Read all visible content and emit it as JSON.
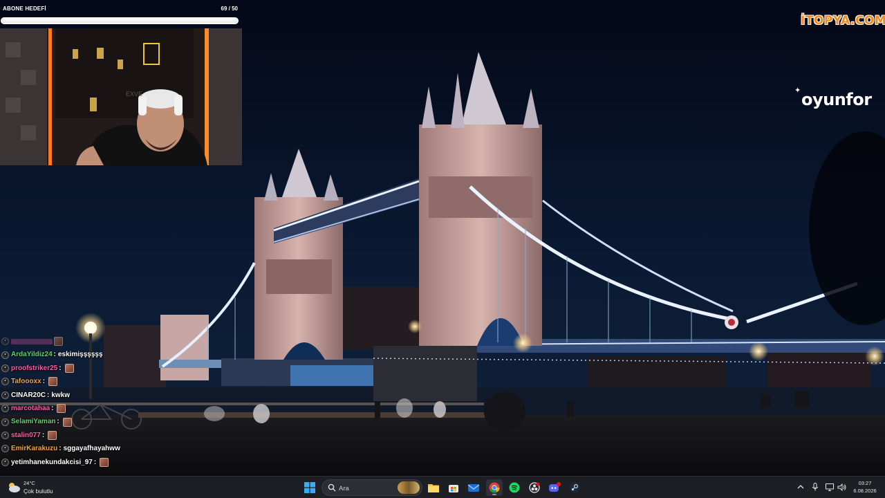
{
  "subscriber_goal": {
    "title": "ABONE HEDEFİ",
    "count": "69 / 50",
    "progress": 1.0
  },
  "logos": {
    "itopya": "İTOPYA.COM",
    "oyunfor": "oyunfor"
  },
  "chat": [
    {
      "user": "ArdaYildiz24",
      "color": "#5fd36a",
      "message": "eskimişşşşşş",
      "emote": false
    },
    {
      "user": "proofstriker25",
      "color": "#ff5ba8",
      "message": "",
      "emote": true
    },
    {
      "user": "Tafoooxx",
      "color": "#f2a640",
      "message": "",
      "emote": true
    },
    {
      "user": "CINAR20C",
      "color": "#ffffff",
      "message": "kwkw",
      "emote": false
    },
    {
      "user": "marcotahaa",
      "color": "#ff5ba8",
      "message": "",
      "emote": true
    },
    {
      "user": "SelamiYaman",
      "color": "#5fd36a",
      "message": "",
      "emote": true
    },
    {
      "user": "stalin077",
      "color": "#ff5ba8",
      "message": "",
      "emote": true
    },
    {
      "user": "EmirKarakuzu",
      "color": "#f2a640",
      "message": "sggayafhayahww",
      "emote": false
    },
    {
      "user": "yetimhanekundakcisi_97",
      "color": "#ffffff",
      "message": "",
      "emote": true
    }
  ],
  "taskbar": {
    "weather": {
      "temp": "24°C",
      "condition": "Çok bulutlu",
      "icon": "cloud-sun-icon"
    },
    "search_placeholder": "Ara",
    "apps": [
      "windows-start-icon",
      "file-explorer-icon",
      "microsoft-store-icon",
      "mail-icon",
      "chrome-icon",
      "spotify-icon",
      "obs-icon",
      "discord-icon",
      "steam-icon"
    ],
    "tray": [
      "chevron-up-icon",
      "microphone-icon",
      "display-icon",
      "volume-icon"
    ],
    "clock": {
      "time": "03:27",
      "date": "6.08.2026"
    }
  },
  "colors": {
    "taskbar": "#1d1f24",
    "sky": "#081228",
    "accent_orange": "#f28a1b"
  }
}
